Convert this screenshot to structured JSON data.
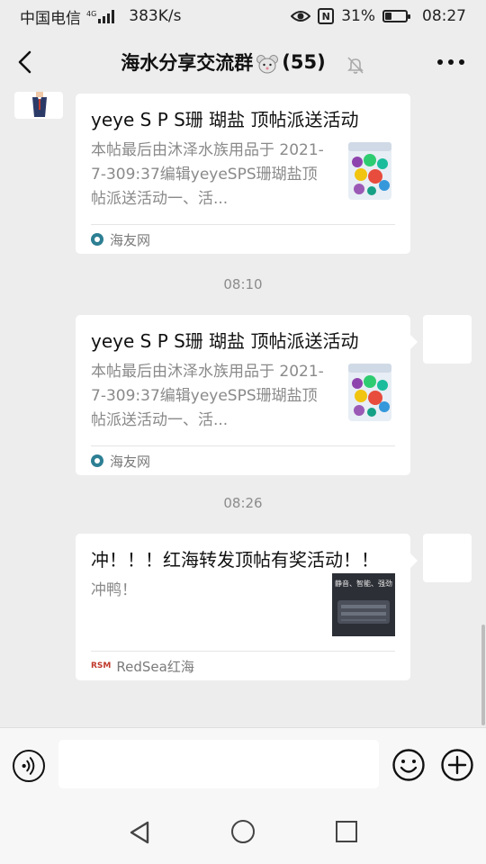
{
  "status_bar": {
    "carrier": "中国电信",
    "network": "4G",
    "speed": "383K/s",
    "battery_percent": "31%",
    "battery_level": 0.31,
    "time": "08:27",
    "icons": [
      "signal-icon",
      "eye-comfort-icon",
      "nfc-icon",
      "battery-icon"
    ]
  },
  "header": {
    "title": "海水分享交流群",
    "member_count": "(55)",
    "icons": [
      "back-arrow-icon",
      "mouse-emoji-icon",
      "mute-bell-icon",
      "more-icon"
    ]
  },
  "messages": [
    {
      "type": "link-card",
      "side": "left",
      "title": "yeye S P S珊 瑚盐 顶帖派送活动",
      "description": "本帖最后由沐泽水族用品于 2021-7-309:37编辑yeyeSPS珊瑚盐顶帖派送活动一、活...",
      "source": "海友网",
      "thumbnail": "salt-bucket-image"
    },
    {
      "type": "time",
      "text": "08:10"
    },
    {
      "type": "link-card",
      "side": "right",
      "title": "yeye S P S珊 瑚盐 顶帖派送活动",
      "description": "本帖最后由沐泽水族用品于 2021-7-309:37编辑yeyeSPS珊瑚盐顶帖派送活动一、活...",
      "source": "海友网",
      "thumbnail": "salt-bucket-image"
    },
    {
      "type": "time",
      "text": "08:26"
    },
    {
      "type": "link-card",
      "side": "right",
      "title": "冲！！！红海转发顶帖有奖活动！！",
      "description": "冲鸭！",
      "source": "RedSea红海",
      "thumbnail": "product-banner-image",
      "thumbnail_caption": "静音、智能、强劲"
    }
  ],
  "input_bar": {
    "icons": [
      "voice-icon",
      "emoji-icon",
      "plus-icon"
    ]
  },
  "colors": {
    "background": "#ededed",
    "bubble": "#ffffff",
    "secondary_text": "#8a8a8a"
  }
}
